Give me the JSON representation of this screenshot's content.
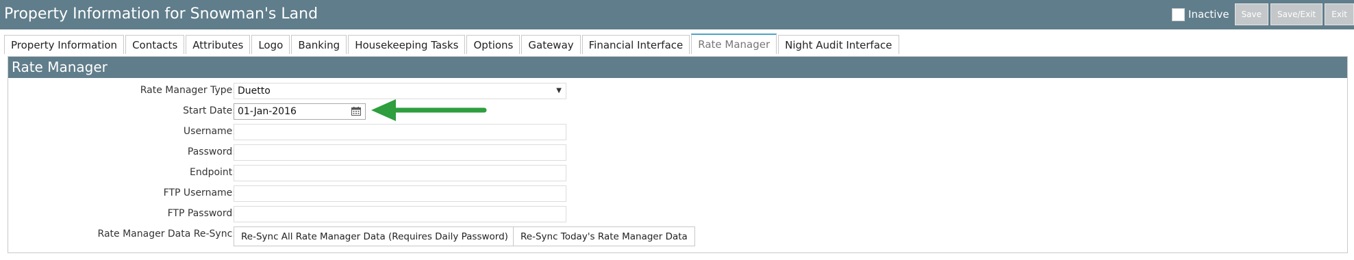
{
  "header": {
    "title": "Property Information for Snowman's Land",
    "inactive_label": "Inactive",
    "save_label": "Save",
    "save_exit_label": "Save/Exit",
    "exit_label": "Exit"
  },
  "tabs": [
    {
      "label": "Property Information"
    },
    {
      "label": "Contacts"
    },
    {
      "label": "Attributes"
    },
    {
      "label": "Logo"
    },
    {
      "label": "Banking"
    },
    {
      "label": "Housekeeping Tasks"
    },
    {
      "label": "Options"
    },
    {
      "label": "Gateway"
    },
    {
      "label": "Financial Interface"
    },
    {
      "label": "Rate Manager"
    },
    {
      "label": "Night Audit Interface"
    }
  ],
  "active_tab": "Rate Manager",
  "panel": {
    "title": "Rate Manager",
    "fields": {
      "rate_manager_type": {
        "label": "Rate Manager Type:",
        "value": "Duetto"
      },
      "start_date": {
        "label": "Start Date:",
        "value": "01-Jan-2016"
      },
      "username": {
        "label": "Username:",
        "value": ""
      },
      "password": {
        "label": "Password:",
        "value": ""
      },
      "endpoint": {
        "label": "Endpoint:",
        "value": ""
      },
      "ftp_username": {
        "label": "FTP Username:",
        "value": ""
      },
      "ftp_password": {
        "label": "FTP Password:",
        "value": ""
      }
    },
    "resync": {
      "label": "Rate Manager Data Re-Sync:",
      "all_button": "Re-Sync All Rate Manager Data (Requires Daily Password)",
      "today_button": "Re-Sync Today's Rate Manager Data"
    }
  },
  "colors": {
    "header_bg": "#607d8b",
    "active_tab_accent": "#4aa3c7",
    "annotation_arrow": "#2e9e3e"
  },
  "icons": {
    "calendar": "calendar-icon",
    "dropdown": "chevron-down-icon",
    "annotation": "green-arrow-left"
  }
}
